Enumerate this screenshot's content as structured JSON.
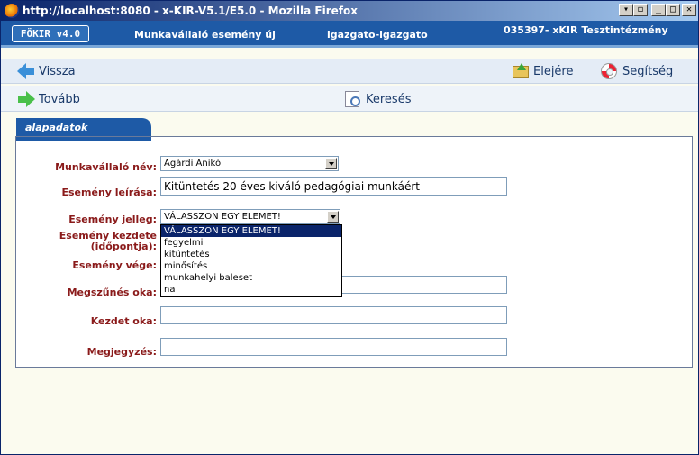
{
  "window": {
    "title": "http://localhost:8080 - x-KIR-V5.1/E5.0 - Mozilla Firefox"
  },
  "header": {
    "logo": "FÖKIR v4.0",
    "page_title": "Munkavállaló esemény új",
    "user": "igazgato-igazgato",
    "institution": "035397- xKIR Tesztintézmény"
  },
  "toolbar1": {
    "back": "Vissza",
    "home": "Elejére",
    "help": "Segítség"
  },
  "toolbar2": {
    "next": "Tovább",
    "search": "Keresés"
  },
  "tab": {
    "label": "alapadatok"
  },
  "form": {
    "employee_label": "Munkavállaló név:",
    "employee_value": "Agárdi Anikó",
    "description_label": "Esemény leírása:",
    "description_value": "Kitüntetés 20 éves kiváló pedagógiai munkáért",
    "type_label": "Esemény jelleg:",
    "type_value": "VÁLASSZON EGY ELEMET!",
    "start_label_1": "Esemény kezdete",
    "start_label_2": "(időpontja):",
    "end_label": "Esemény vége:",
    "termination_reason_label": "Megszűnés oka:",
    "start_reason_label": "Kezdet oka:",
    "note_label": "Megjegyzés:"
  },
  "dropdown_options": [
    "VÁLASSZON EGY ELEMET!",
    "fegyelmi",
    "kitüntetés",
    "minősítés",
    "munkahelyi baleset",
    "na"
  ]
}
